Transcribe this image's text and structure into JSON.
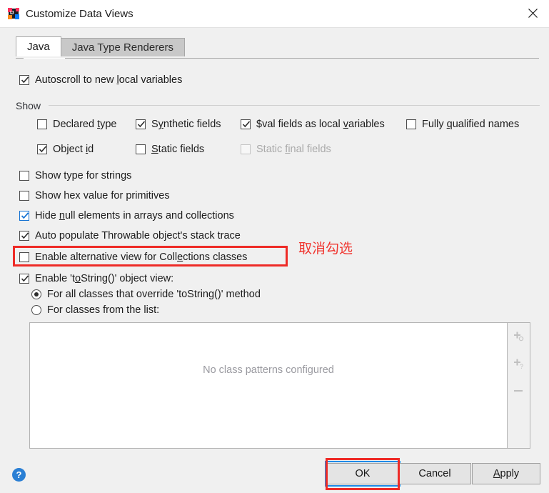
{
  "window": {
    "title": "Customize Data Views",
    "app_icon": "intellij-idea-icon",
    "close_icon": "close-icon"
  },
  "tabs": [
    {
      "label": "Java",
      "selected": true
    },
    {
      "label": "Java Type Renderers",
      "selected": false
    }
  ],
  "options": {
    "autoscroll": {
      "label_before": "Autoscroll to new ",
      "label_mnemonic": "l",
      "label_after": "ocal variables",
      "checked": true,
      "style": "dark"
    }
  },
  "show_group": {
    "label": "Show",
    "items": [
      {
        "id": "declared-type",
        "before": "Declared ",
        "mnemonic": "t",
        "after": "ype",
        "checked": false,
        "disabled": false
      },
      {
        "id": "synthetic-fields",
        "before": "S",
        "mnemonic": "y",
        "after": "nthetic fields",
        "checked": true,
        "disabled": false
      },
      {
        "id": "val-fields-as-local-variables",
        "before": "$val fields as local ",
        "mnemonic": "v",
        "after": "ariables",
        "checked": true,
        "disabled": false
      },
      {
        "id": "fully-qualified-names",
        "before": "Fully ",
        "mnemonic": "q",
        "after": "ualified names",
        "checked": false,
        "disabled": false
      },
      {
        "id": "object-id",
        "before": "Object ",
        "mnemonic": "i",
        "after": "d",
        "checked": true,
        "disabled": false
      },
      {
        "id": "static-fields",
        "before": "",
        "mnemonic": "S",
        "after": "tatic fields",
        "checked": false,
        "disabled": false
      },
      {
        "id": "static-final-fields",
        "before": "Static ",
        "mnemonic": "fi",
        "after": "nal fields",
        "checked": false,
        "disabled": true
      }
    ]
  },
  "main_options": [
    {
      "id": "show-type-for-strings",
      "before": "Show type for strings",
      "mnemonic": "",
      "after": "",
      "checked": false,
      "style": "dark"
    },
    {
      "id": "show-hex-value-for-primitives",
      "before": "Show hex value for primitives",
      "mnemonic": "",
      "after": "",
      "checked": false,
      "style": "dark"
    },
    {
      "id": "hide-null-elements",
      "before": "Hide ",
      "mnemonic": "n",
      "after": "ull elements in arrays and collections",
      "checked": true,
      "style": "blue"
    },
    {
      "id": "auto-populate-throwable",
      "before": "Auto populate Throwable object's stack trace",
      "mnemonic": "",
      "after": "",
      "checked": true,
      "style": "dark"
    },
    {
      "id": "enable-alternative-collections-view",
      "before": "Enable alternative view for Coll",
      "mnemonic": "e",
      "after": "ctions classes",
      "checked": false,
      "style": "dark"
    },
    {
      "id": "enable-tostring-object-view",
      "before": "Enable 't",
      "mnemonic": "o",
      "after": "String()' object view:",
      "checked": true,
      "style": "dark"
    }
  ],
  "tostring_radios": [
    {
      "id": "for-all-classes-override",
      "label": "For all classes that override 'toString()' method",
      "selected": true
    },
    {
      "id": "for-classes-from-list",
      "label": "For classes from the list:",
      "selected": false
    }
  ],
  "class_list": {
    "empty_text": "No class patterns configured",
    "toolbar": [
      {
        "id": "add-pattern-button",
        "icon": "plus-circle-icon"
      },
      {
        "id": "add-pattern-help-button",
        "icon": "plus-question-icon"
      },
      {
        "id": "remove-pattern-button",
        "icon": "minus-icon"
      }
    ]
  },
  "buttons": {
    "help": {
      "label": "?",
      "icon": "help-icon"
    },
    "ok": {
      "before": "",
      "mnemonic": "",
      "after": "OK",
      "focused": true
    },
    "cancel": {
      "before": "Cancel",
      "mnemonic": "",
      "after": ""
    },
    "apply": {
      "before": "",
      "mnemonic": "A",
      "after": "pply"
    }
  },
  "annotations": {
    "uncheck_note": "取消勾选",
    "highlight_color": "#ee2b27"
  }
}
